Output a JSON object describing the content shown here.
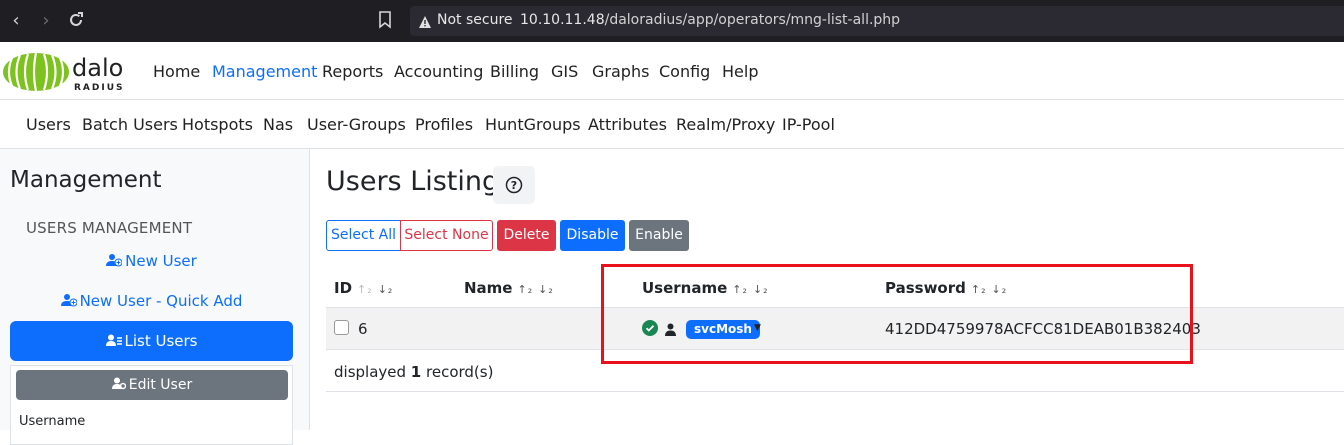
{
  "browser": {
    "not_secure": "Not secure",
    "url_host": "10.10.11.48",
    "url_path": "/daloradius/app/operators/mng-list-all.php"
  },
  "logo": {
    "brand_top": "dalo",
    "brand_bottom": "RADIUS"
  },
  "topnav": [
    "Home",
    "Management",
    "Reports",
    "Accounting",
    "Billing",
    "GIS",
    "Graphs",
    "Config",
    "Help"
  ],
  "subnav": [
    "Users",
    "Batch Users",
    "Hotspots",
    "Nas",
    "User-Groups",
    "Profiles",
    "HuntGroups",
    "Attributes",
    "Realm/Proxy",
    "IP-Pool"
  ],
  "sidebar": {
    "title": "Management",
    "section": "USERS MANAGEMENT",
    "new_user": "New User",
    "new_user_quick": "New User - Quick Add",
    "list_users": "List Users",
    "edit_user": "Edit User",
    "username_label": "Username"
  },
  "main": {
    "title": "Users Listing",
    "buttons": {
      "select_all": "Select All",
      "select_none": "Select None",
      "delete": "Delete",
      "disable": "Disable",
      "enable": "Enable"
    },
    "columns": [
      "ID",
      "Name",
      "Username",
      "Password"
    ],
    "rows": [
      {
        "id": "6",
        "name": "",
        "username": "svcMosh",
        "password": "412DD4759978ACFCC81DEAB01B382403"
      }
    ],
    "footer": {
      "prefix": "displayed",
      "count": "1",
      "suffix": "record(s)"
    }
  },
  "colors": {
    "accent": "#0d6efd",
    "danger": "#dc3545",
    "secondary": "#6c757d",
    "highlight": "#e8101a"
  }
}
